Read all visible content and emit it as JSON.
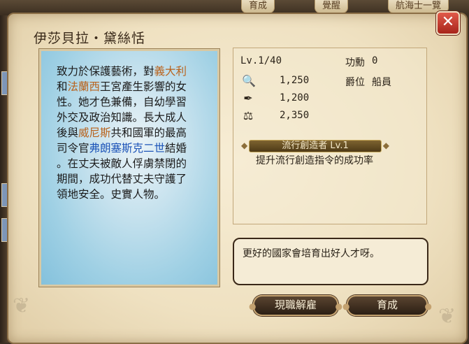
{
  "background_ui": {
    "tabs": [
      "育成",
      "覺醒",
      "航海士一覽"
    ]
  },
  "dialog": {
    "title": "伊莎貝拉・黛絲恬",
    "close_symbol": "✕"
  },
  "bio": {
    "segments": [
      {
        "text": "致力於保護藝術，對",
        "hl": ""
      },
      {
        "text": "義大利",
        "hl": "orange"
      },
      {
        "text": "\n和",
        "hl": ""
      },
      {
        "text": "法蘭西",
        "hl": "orange"
      },
      {
        "text": "王宮產生影響的女\n性。她才色兼備，自幼學習\n外交及政治知識。長大成人\n後與",
        "hl": ""
      },
      {
        "text": "威尼斯",
        "hl": "orange"
      },
      {
        "text": "共和國軍的最高\n司令官",
        "hl": ""
      },
      {
        "text": "弗朗塞斯克二世",
        "hl": "blue"
      },
      {
        "text": "結婚\n。在丈夫被敵人俘虜禁閉的\n期間，成功代替丈夫守護了\n領地安全。史實人物。",
        "hl": ""
      }
    ]
  },
  "stats": {
    "level": "Lv.1/40",
    "merit_label": "功勳",
    "merit_value": "0",
    "rank_label": "爵位",
    "rank_value": "船員",
    "rows": [
      {
        "icon": "magnifier-icon",
        "glyph": "🔍",
        "value": "1,250"
      },
      {
        "icon": "compass-icon",
        "glyph": "✒",
        "value": "1,200"
      },
      {
        "icon": "scales-icon",
        "glyph": "⚖",
        "value": "2,350"
      }
    ],
    "trait_name": "流行創造者 Lv.1",
    "trait_desc": "提升流行創造指令的成功率"
  },
  "quote": "更好的國家會培育出好人才呀。",
  "buttons": {
    "dismiss": "現職解雇",
    "train": "育成"
  }
}
